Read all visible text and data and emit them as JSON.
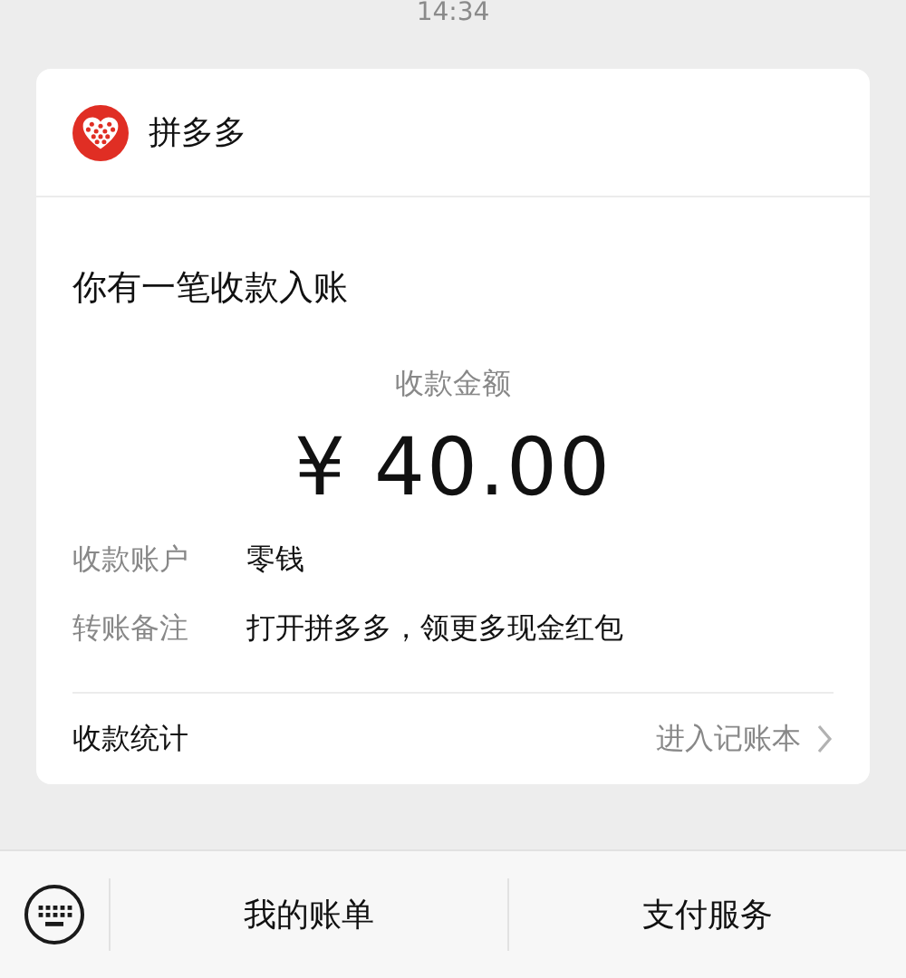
{
  "status_time": "14:34",
  "card": {
    "app_name": "拼多多",
    "title": "你有一笔收款入账",
    "amount_label": "收款金额",
    "amount": "¥ 40.00",
    "details": [
      {
        "label": "收款账户",
        "value": "零钱"
      },
      {
        "label": "转账备注",
        "value": "打开拼多多，领更多现金红包"
      }
    ],
    "footer": {
      "label": "收款统计",
      "link": "进入记账本"
    }
  },
  "bottom_menu": [
    "我的账单",
    "支付服务"
  ]
}
